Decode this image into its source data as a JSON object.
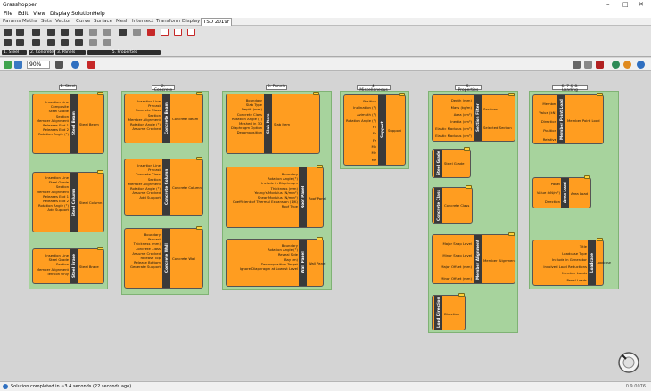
{
  "app": {
    "title": "Grasshopper",
    "version": "0.9.0076"
  },
  "window_controls": [
    "–",
    "□",
    "✕"
  ],
  "menu": [
    "File",
    "Edit",
    "View",
    "Display",
    "Solution",
    "Help"
  ],
  "tabs": [
    "Params",
    "Maths",
    "Sets",
    "Vector",
    "Curve",
    "Surface",
    "Mesh",
    "Intersect",
    "Transform",
    "Display",
    "TSD 2019r"
  ],
  "active_tab": "TSD 2019r",
  "ribbon_groups": [
    "1. Steel",
    "2. Concrete",
    "3. Panels",
    "5. Properties"
  ],
  "canvas_toolbar": {
    "zoom": "90%"
  },
  "groups": [
    {
      "label": "1. Steel",
      "components": [
        {
          "title": "Steel Beam",
          "inputs": [
            "Insertion Line",
            "Composite",
            "Steel Grade",
            "Section",
            "Member Alignment",
            "Releases End 1",
            "Releases End 2",
            "Rotation Angle (°)"
          ],
          "output": "Steel Beam"
        },
        {
          "title": "Steel Column",
          "inputs": [
            "Insertion Line",
            "Steel Grade",
            "Section",
            "Member Alignment",
            "Releases End 1",
            "Releases End 2",
            "Rotation Angle (°)",
            "Add Support"
          ],
          "output": "Steel Column"
        },
        {
          "title": "Steel Brace",
          "inputs": [
            "Insertion Line",
            "Steel Grade",
            "Section",
            "Member Alignment",
            "Tension Only"
          ],
          "output": "Steel Brace"
        }
      ]
    },
    {
      "label": "2. Concrete",
      "components": [
        {
          "title": "Concrete Beam",
          "inputs": [
            "Insertion Line",
            "Precast",
            "Concrete Class",
            "Section",
            "Member Alignment",
            "Rotation Angle (°)",
            "Assume Cracked"
          ],
          "output": "Concrete Beam"
        },
        {
          "title": "Concrete Column",
          "inputs": [
            "Insertion Line",
            "Precast",
            "Concrete Class",
            "Section",
            "Member Alignment",
            "Rotation Angle (°)",
            "Assume Cracked",
            "Add Support"
          ],
          "output": "Concrete Column"
        },
        {
          "title": "Concrete Wall",
          "inputs": [
            "Boundary",
            "Precast",
            "Thickness (mm)",
            "Concrete Class",
            "Assume Cracked",
            "Release Top",
            "Release Bottom",
            "Generate Support"
          ],
          "output": "Concrete Wall"
        }
      ]
    },
    {
      "label": "3. Panels",
      "components": [
        {
          "title": "Slab Item",
          "inputs": [
            "Boundary",
            "Slab Type",
            "Depth (mm)",
            "Concrete Class",
            "Rotation Angle (°)",
            "Meshed in 3D",
            "Diaphragm Option",
            "Decomposition"
          ],
          "output": "Slab Item"
        },
        {
          "title": "Roof Panel",
          "inputs": [
            "Boundary",
            "Rotation Angle (°)",
            "Include in Diaphragm",
            "Thickness (mm)",
            "Young's Modulus (N/mm²)",
            "Shear Modulus (N/mm²)",
            "Coefficient of Thermal Expansion (1/K)",
            "Roof Type"
          ],
          "output": "Roof Panel"
        },
        {
          "title": "Wall Panel",
          "inputs": [
            "Boundary",
            "Rotation Angle (°)",
            "Reveal Side",
            "Bay (m)",
            "Decomposition Target",
            "Ignore Diaphragm at Lowest Level"
          ],
          "output": "Wall Panel"
        }
      ]
    },
    {
      "label": "4. Miscellaneous",
      "components": [
        {
          "title": "Support",
          "inputs": [
            "Position",
            "Inclination (°)",
            "Azimuth (°)",
            "Rotation Angle (°)",
            "Fx",
            "Fy",
            "Fz",
            "Mx",
            "My",
            "Mz"
          ],
          "output": "Support"
        }
      ]
    },
    {
      "label": "5. Properties",
      "components": [
        {
          "title": "Section Filter",
          "inputs": [
            "Depth (mm)",
            "Mass (kg/m)",
            "Area (cm²)",
            "Inertia (cm⁴)",
            "Elastic Modulus (cm³)",
            "Elastic Modulus (cm³)"
          ],
          "output": "Sections",
          "output2": "Selected Section"
        },
        {
          "title": "Steel Grade",
          "inputs": [],
          "output": "Steel Grade"
        },
        {
          "title": "Concrete Class",
          "inputs": [],
          "output": "Concrete Class"
        },
        {
          "title": "Member Alignment",
          "inputs": [
            "Major Snap Level",
            "Minor Snap Level",
            "Major Offset (mm)",
            "Minor Offset (mm)"
          ],
          "output": "Member Alignment"
        },
        {
          "title": "Load Direction",
          "inputs": [],
          "output": "Direction"
        }
      ]
    },
    {
      "label": "6, 7 & 8. Loading",
      "components": [
        {
          "title": "Member Point Load",
          "inputs": [
            "Member",
            "Value (kN)",
            "Direction",
            "Position",
            "Relative"
          ],
          "output": "Member Point Load"
        },
        {
          "title": "Area Load",
          "inputs": [
            "Panel",
            "Value (kN/m²)",
            "Direction"
          ],
          "output": "Area Load"
        },
        {
          "title": "Loadcase",
          "inputs": [
            "Title",
            "Loadcase Type",
            "Include in Generator",
            "Involved Load Reductions",
            "Member Loads",
            "Panel Loads"
          ],
          "output": "Loadcase"
        }
      ]
    }
  ],
  "status": {
    "message": "Solution completed in ~3.4 seconds (22 seconds ago)"
  },
  "colors": {
    "component": "#ff9d20",
    "group": "#a7d39d",
    "bar": "#3a3a3a"
  }
}
